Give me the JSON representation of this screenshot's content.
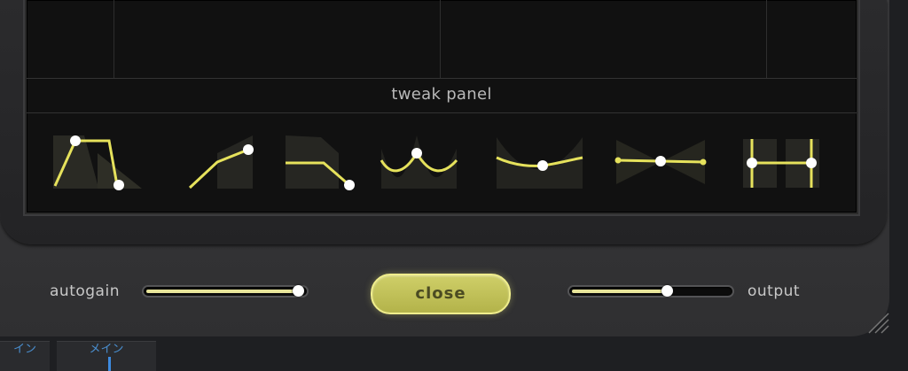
{
  "tweak_panel": {
    "label": "tweak panel",
    "shapes": [
      {
        "name": "shape-lowpass-icon"
      },
      {
        "name": "shape-rise-icon"
      },
      {
        "name": "shape-fall-icon"
      },
      {
        "name": "shape-sine-icon"
      },
      {
        "name": "shape-dip-icon"
      },
      {
        "name": "shape-tilt-icon"
      },
      {
        "name": "shape-bracket-icon"
      }
    ]
  },
  "controls": {
    "autogain_label": "autogain",
    "autogain_value": 0.98,
    "close_label": "close",
    "output_label": "output",
    "output_value": 0.6
  },
  "host_tabs": [
    {
      "label": "イン"
    },
    {
      "label": "メイン"
    }
  ],
  "colors": {
    "accent": "#e8e59a",
    "curve": "#e6e25c",
    "button": "#c4c45a"
  }
}
